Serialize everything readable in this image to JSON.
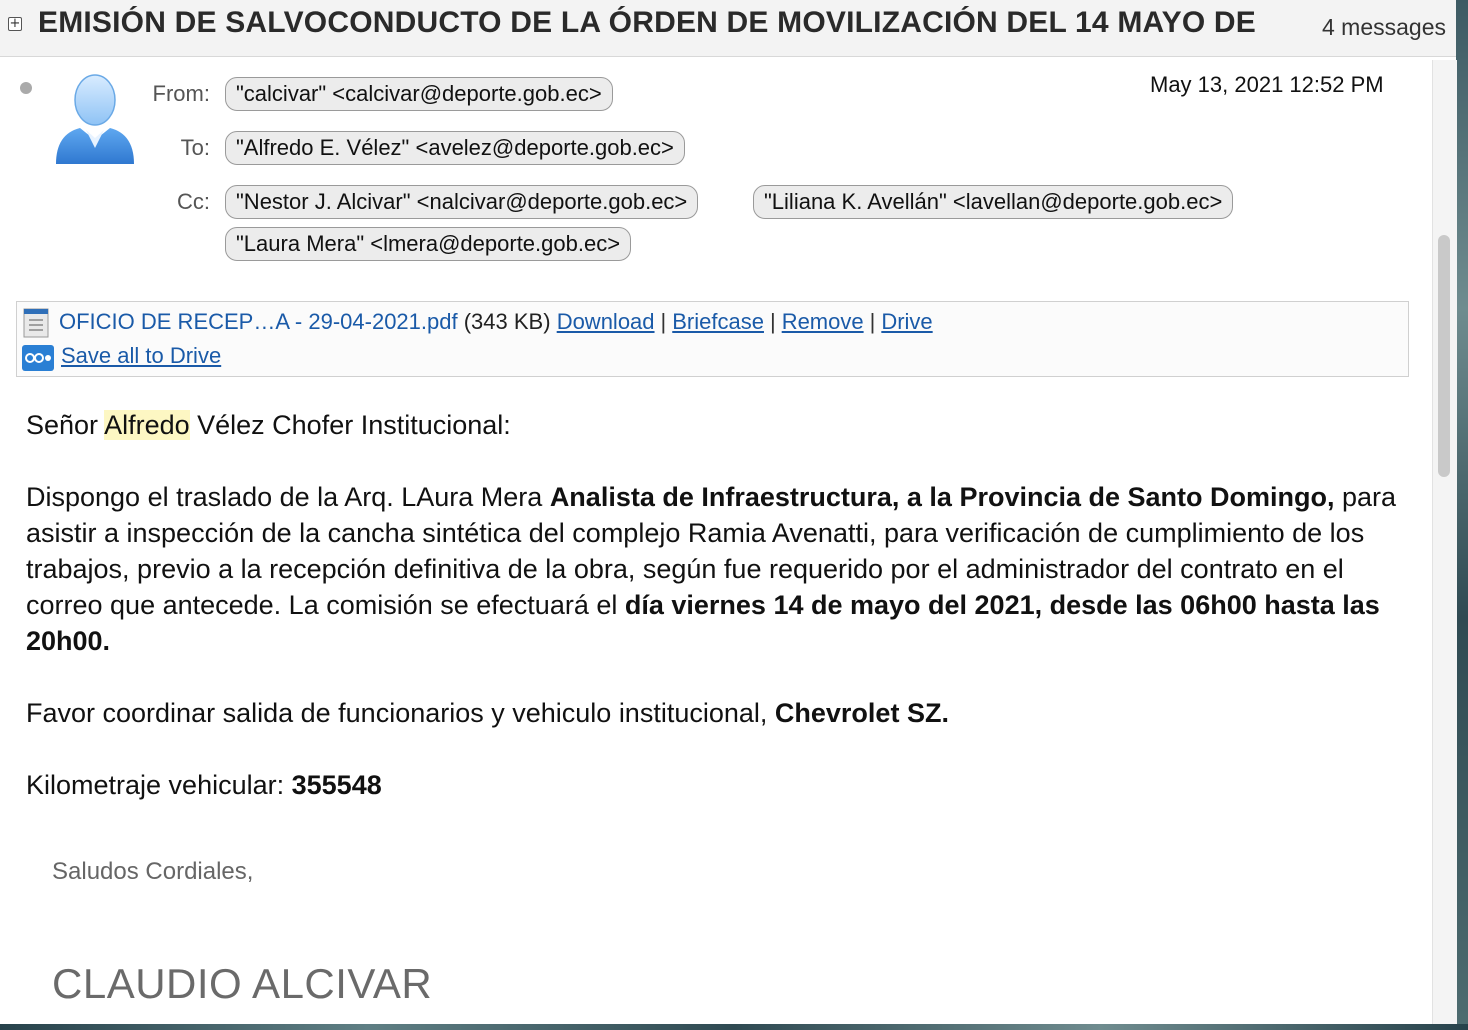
{
  "thread": {
    "expand_symbol": "+",
    "subject": "EMISIÓN DE SALVOCONDUCTO DE LA ÓRDEN DE MOVILIZACIÓN DEL 14 MAYO DE",
    "message_count": "4 messages"
  },
  "message": {
    "from_label": "From:",
    "to_label": "To:",
    "cc_label": "Cc:",
    "from": "\"calcivar\" <calcivar@deporte.gob.ec>",
    "to": "\"Alfredo E. Vélez\" <avelez@deporte.gob.ec>",
    "cc": [
      "\"Nestor J. Alcivar\" <nalcivar@deporte.gob.ec>",
      "\"Liliana K. Avellán\" <lavellan@deporte.gob.ec>",
      "\"Laura Mera\" <lmera@deporte.gob.ec>"
    ],
    "date": "May 13, 2021 12:52 PM"
  },
  "attachment": {
    "file_name": "OFICIO DE RECEP…A - 29-04-2021.pdf",
    "file_size": "(343 KB)",
    "download_label": "Download",
    "briefcase_label": "Briefcase",
    "remove_label": "Remove",
    "drive_label": "Drive",
    "separator": "|",
    "save_all_label": "Save all to Drive"
  },
  "body": {
    "greeting_pre": "Señor ",
    "greeting_highlight": "Alfredo",
    "greeting_post": " Vélez Chofer Institucional:",
    "p1_a": "Dispongo el traslado de la Arq. LAura Mera ",
    "p1_b_bold": "Analista de Infraestructura,  a la Provincia de Santo Domingo,",
    "p1_c": "  para asistir a inspección de la cancha sintética del complejo Ramia Avenatti, para verificación de cumplimiento de los trabajos, previo a la recepción definitiva de la obra, según fue requerido por el administrador del contrato en el correo que antecede. La comisión se efectuará el ",
    "p1_d_bold": "día viernes 14 de mayo del 2021, desde las 06h00 hasta las 20h00.",
    "p2_a": "Favor coordinar salida de funcionarios y vehiculo institucional, ",
    "p2_b_bold": "Chevrolet SZ.",
    "p3_a": "Kilometraje vehicular: ",
    "p3_b_bold": "355548",
    "signature_greeting": "Saludos Cordiales,",
    "signature_name": "CLAUDIO ALCIVAR"
  },
  "icons": {
    "avatar": "person-avatar-icon",
    "pdf": "pdf-file-icon",
    "drive": "drive-icon",
    "expand": "expand-plus-icon"
  },
  "colors": {
    "link": "#1a5aa8",
    "highlight": "#fdf7c3",
    "avatar_blue": "#3f8fe0"
  }
}
